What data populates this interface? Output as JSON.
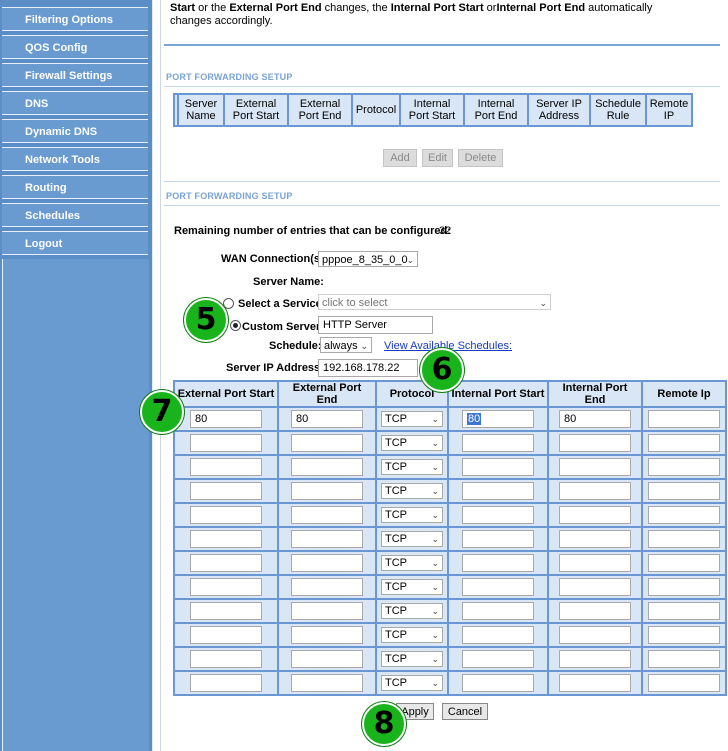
{
  "sidebar": {
    "items": [
      {
        "label": "Filtering Options"
      },
      {
        "label": "QOS Config"
      },
      {
        "label": "Firewall Settings"
      },
      {
        "label": "DNS"
      },
      {
        "label": "Dynamic DNS"
      },
      {
        "label": "Network Tools"
      },
      {
        "label": "Routing"
      },
      {
        "label": "Schedules"
      },
      {
        "label": "Logout"
      }
    ]
  },
  "note": {
    "start": "Start",
    "t1": " or the ",
    "ext_end": "External Port End",
    "t2": " changes, the ",
    "int_start": "Internal Port Start",
    "t3": " or",
    "int_end": "Internal Port End",
    "t4": " automatically changes accordingly."
  },
  "setup1": {
    "title": "PORT FORWARDING SETUP",
    "headers": [
      "Server Name",
      "External Port Start",
      "External Port End",
      "Protocol",
      "Internal Port Start",
      "Internal Port End",
      "Server IP Address",
      "Schedule Rule",
      "Remote IP"
    ],
    "buttons": {
      "add": "Add",
      "edit": "Edit",
      "delete": "Delete"
    }
  },
  "setup2": {
    "title": "PORT FORWARDING SETUP",
    "remaining_label": "Remaining number of entries that can be configured:",
    "remaining_value": "32",
    "wan_label": "WAN Connection(s)",
    "wan_value": "pppoe_8_35_0_0",
    "server_name_label": "Server Name:",
    "select_service_label": "Select a Service:",
    "select_service_placeholder": "click to select",
    "custom_server_label": "Custom Server:",
    "custom_server_value": "HTTP Server",
    "schedule_label": "Schedule:",
    "schedule_value": "always",
    "view_schedules_link": "View Available Schedules:",
    "server_ip_label": "Server IP Address:",
    "server_ip_value": "192.168.178.22"
  },
  "rules_table": {
    "headers": [
      "External Port Start",
      "External Port End",
      "Protocol",
      "Internal Port Start",
      "Internal Port End",
      "Remote Ip"
    ],
    "rows": [
      {
        "ext_start": "80",
        "ext_end": "80",
        "protocol": "TCP",
        "int_start": "80",
        "int_end": "80",
        "remote": ""
      },
      {
        "ext_start": "",
        "ext_end": "",
        "protocol": "TCP",
        "int_start": "",
        "int_end": "",
        "remote": ""
      },
      {
        "ext_start": "",
        "ext_end": "",
        "protocol": "TCP",
        "int_start": "",
        "int_end": "",
        "remote": ""
      },
      {
        "ext_start": "",
        "ext_end": "",
        "protocol": "TCP",
        "int_start": "",
        "int_end": "",
        "remote": ""
      },
      {
        "ext_start": "",
        "ext_end": "",
        "protocol": "TCP",
        "int_start": "",
        "int_end": "",
        "remote": ""
      },
      {
        "ext_start": "",
        "ext_end": "",
        "protocol": "TCP",
        "int_start": "",
        "int_end": "",
        "remote": ""
      },
      {
        "ext_start": "",
        "ext_end": "",
        "protocol": "TCP",
        "int_start": "",
        "int_end": "",
        "remote": ""
      },
      {
        "ext_start": "",
        "ext_end": "",
        "protocol": "TCP",
        "int_start": "",
        "int_end": "",
        "remote": ""
      },
      {
        "ext_start": "",
        "ext_end": "",
        "protocol": "TCP",
        "int_start": "",
        "int_end": "",
        "remote": ""
      },
      {
        "ext_start": "",
        "ext_end": "",
        "protocol": "TCP",
        "int_start": "",
        "int_end": "",
        "remote": ""
      },
      {
        "ext_start": "",
        "ext_end": "",
        "protocol": "TCP",
        "int_start": "",
        "int_end": "",
        "remote": ""
      },
      {
        "ext_start": "",
        "ext_end": "",
        "protocol": "TCP",
        "int_start": "",
        "int_end": "",
        "remote": ""
      }
    ]
  },
  "actions": {
    "apply": "Apply",
    "cancel": "Cancel"
  },
  "markers": [
    "5",
    "6",
    "7",
    "8"
  ],
  "colors": {
    "sidebar": "#6a9bd0",
    "accent": "#7aa3d6",
    "marker": "#19b31c"
  }
}
